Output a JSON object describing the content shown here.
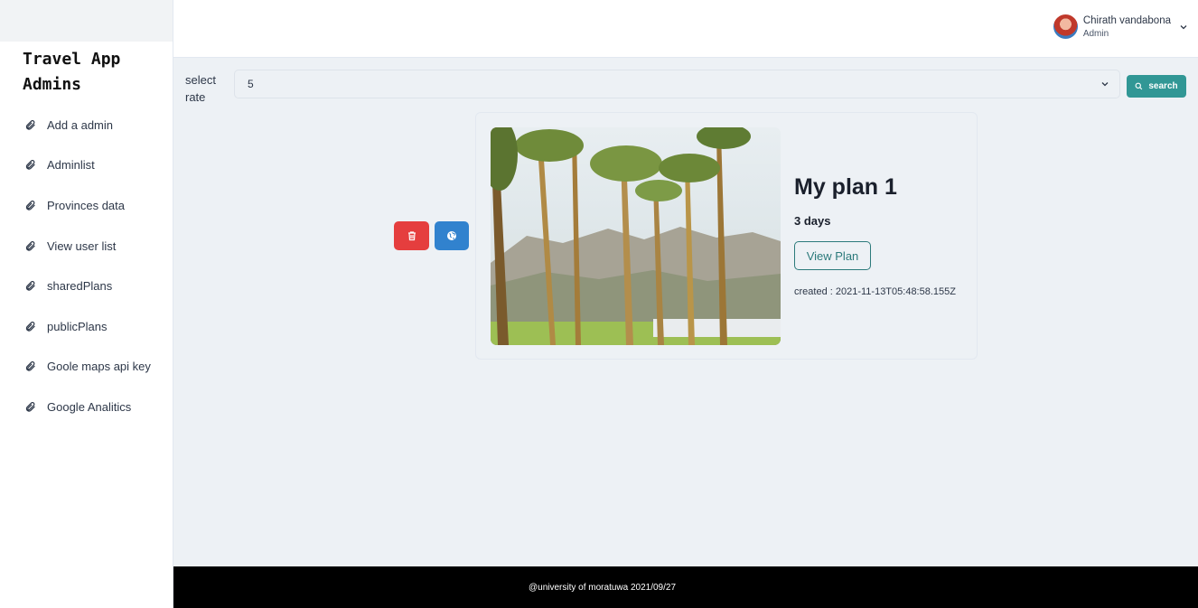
{
  "sidebar": {
    "brand": "Travel App Admins",
    "items": [
      {
        "label": "Add a admin",
        "icon": "paperclip-icon"
      },
      {
        "label": "Adminlist",
        "icon": "paperclip-icon"
      },
      {
        "label": "Provinces data",
        "icon": "paperclip-icon"
      },
      {
        "label": "View user list",
        "icon": "paperclip-icon"
      },
      {
        "label": "sharedPlans",
        "icon": "paperclip-icon"
      },
      {
        "label": "publicPlans",
        "icon": "paperclip-icon"
      },
      {
        "label": "Goole maps api key",
        "icon": "paperclip-icon"
      },
      {
        "label": "Google Analitics",
        "icon": "paperclip-icon"
      }
    ]
  },
  "header": {
    "user_name": "Chirath vandabona",
    "user_role": "Admin"
  },
  "filter": {
    "label": "select rate",
    "selected": "5",
    "search_label": "search"
  },
  "plan": {
    "title": "My plan 1",
    "duration": "3 days",
    "view_label": "View Plan",
    "created": "created : 2021-11-13T05:48:58.155Z"
  },
  "footer": {
    "text": "@university of moratuwa 2021/09/27"
  },
  "colors": {
    "accent": "#319795",
    "delete": "#e53e3e",
    "globe": "#3182ce"
  }
}
